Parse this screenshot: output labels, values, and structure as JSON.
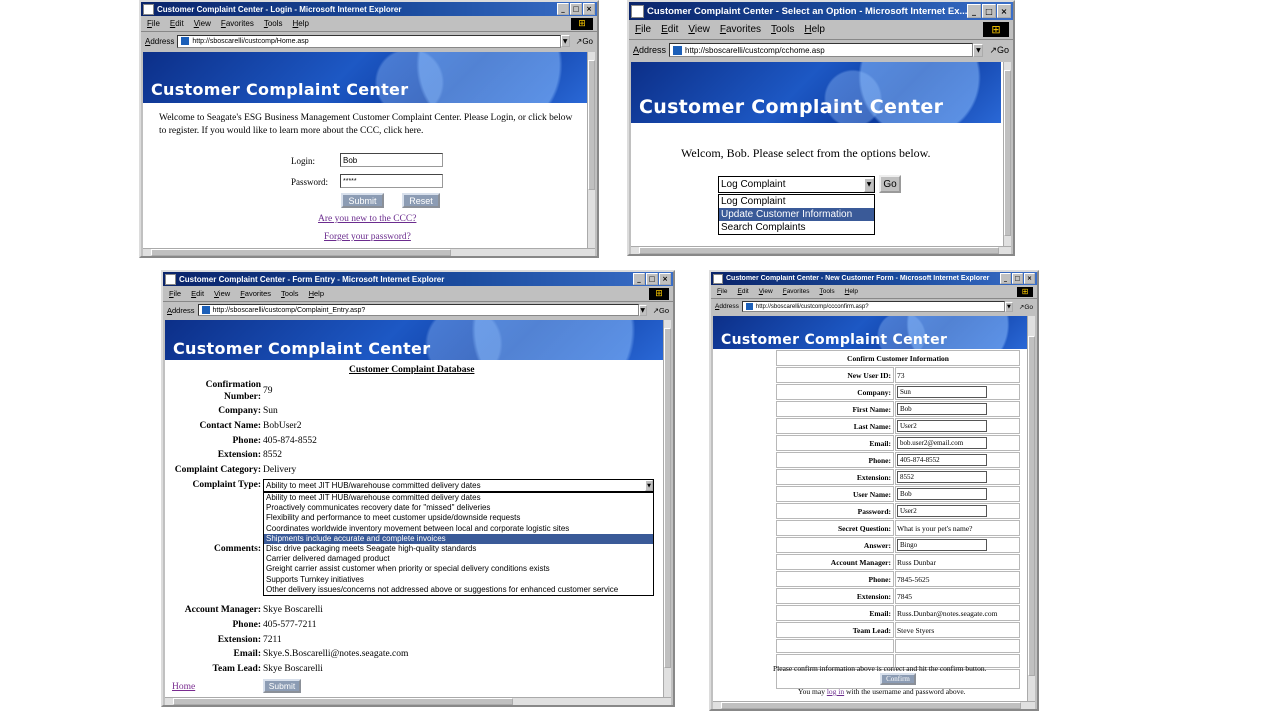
{
  "common": {
    "banner_title": "Customer Complaint Center",
    "menu": [
      "File",
      "Edit",
      "View",
      "Favorites",
      "Tools",
      "Help"
    ],
    "address_label": "Address",
    "go_label": "Go"
  },
  "login_window": {
    "title": "Customer Complaint Center - Login - Microsoft Internet Explorer",
    "url": "http://sboscarelli/custcomp/Home.asp",
    "welcome": "Welcome to Seagate's ESG Business Management Customer Complaint Center. Please Login, or click below to register. If you would like to learn more about the CCC, click here.",
    "login_label": "Login:",
    "login_value": "Bob",
    "password_label": "Password:",
    "password_value": "*****",
    "submit": "Submit",
    "reset": "Reset",
    "new_link": "Are you new to the CCC?",
    "forgot_link": "Forget your password?"
  },
  "option_window": {
    "title": "Customer Complaint Center - Select an Option - Microsoft Internet Ex...",
    "url": "http://sboscarelli/custcomp/cchome.asp",
    "welcome": "Welcom, Bob. Please select from the options below.",
    "selected": "Log Complaint",
    "go_button": "Go",
    "options": [
      "Log Complaint",
      "Update Customer Information",
      "Search Complaints"
    ],
    "highlighted_index": 1
  },
  "form_window": {
    "title": "Customer Complaint Center - Form Entry - Microsoft Internet Explorer",
    "url": "http://sboscarelli/custcomp/Complaint_Entry.asp?",
    "heading": "Customer Complaint Database",
    "confirmation_label": "Confirmation Number:",
    "confirmation_value": "79",
    "rows": [
      {
        "label": "Company:",
        "value": "Sun"
      },
      {
        "label": "Contact Name:",
        "value": "BobUser2"
      },
      {
        "label": "Phone:",
        "value": "405-874-8552"
      },
      {
        "label": "Extension:",
        "value": "8552"
      },
      {
        "label": "Complaint Category:",
        "value": "Delivery"
      }
    ],
    "complaint_type_label": "Complaint Type:",
    "complaint_type_value": "Ability to meet JIT HUB/warehouse committed delivery dates",
    "complaint_options": [
      "Ability to meet JIT HUB/warehouse committed delivery dates",
      "Proactively communicates recovery date for \"missed\" deliveries",
      "Flexibility and performance to meet customer upside/downside requests",
      "Coordinates worldwide inventory movement between local and corporate logistic sites",
      "Shipments include accurate and complete invoices",
      "Disc drive packaging meets Seagate high-quality standards",
      "Carrier delivered damaged product",
      "Greight carrier assist customer when priority or special delivery conditions exists",
      "Supports Turnkey initiatives",
      "Other delivery issues/concerns not addressed above or suggestions for enhanced customer service"
    ],
    "highlighted_index": 4,
    "comments_label": "Comments:",
    "account_rows": [
      {
        "label": "Account Manager:",
        "value": "Skye Boscarelli"
      },
      {
        "label": "Phone:",
        "value": "405-577-7211"
      },
      {
        "label": "Extension:",
        "value": "7211"
      },
      {
        "label": "Email:",
        "value": "Skye.S.Boscarelli@notes.seagate.com"
      },
      {
        "label": "Team Lead:",
        "value": "Skye Boscarelli"
      }
    ],
    "home_link": "Home",
    "submit": "Submit"
  },
  "confirm_window": {
    "title": "Customer Complaint Center - New Customer Form - Microsoft Internet Explorer",
    "url": "http://sboscarelli/custcomp/ccconfirm.asp?",
    "heading": "Confirm Customer Information",
    "rows": [
      {
        "label": "New User ID:",
        "value": "73",
        "input": false
      },
      {
        "label": "Company:",
        "value": "Sun",
        "input": true
      },
      {
        "label": "First Name:",
        "value": "Bob",
        "input": true
      },
      {
        "label": "Last Name:",
        "value": "User2",
        "input": true
      },
      {
        "label": "Email:",
        "value": "bob.user2@email.com",
        "input": true
      },
      {
        "label": "Phone:",
        "value": "405-874-8552",
        "input": true
      },
      {
        "label": "Extension:",
        "value": "8552",
        "input": true
      },
      {
        "label": "User Name:",
        "value": "Bob",
        "input": true
      },
      {
        "label": "Password:",
        "value": "User2",
        "input": true
      },
      {
        "label": "Secret Question:",
        "value": "What is your pet's name?",
        "input": false
      },
      {
        "label": "Answer:",
        "value": "Bingo",
        "input": true
      },
      {
        "label": "Account Manager:",
        "value": "Russ Dunbar",
        "input": false
      },
      {
        "label": "Phone:",
        "value": "7845-5625",
        "input": false
      },
      {
        "label": "Extension:",
        "value": "7845",
        "input": false
      },
      {
        "label": "Email:",
        "value": "Russ.Dunbar@notes.seagate.com",
        "input": false
      },
      {
        "label": "Team Lead:",
        "value": "Steve Styers",
        "input": false
      }
    ],
    "confirm_button": "Confirm",
    "note": "Please confirm information above is correct and hit the confirm button.",
    "login_prefix": "You may",
    "login_link": "log in",
    "login_suffix": "with the username and password above."
  }
}
